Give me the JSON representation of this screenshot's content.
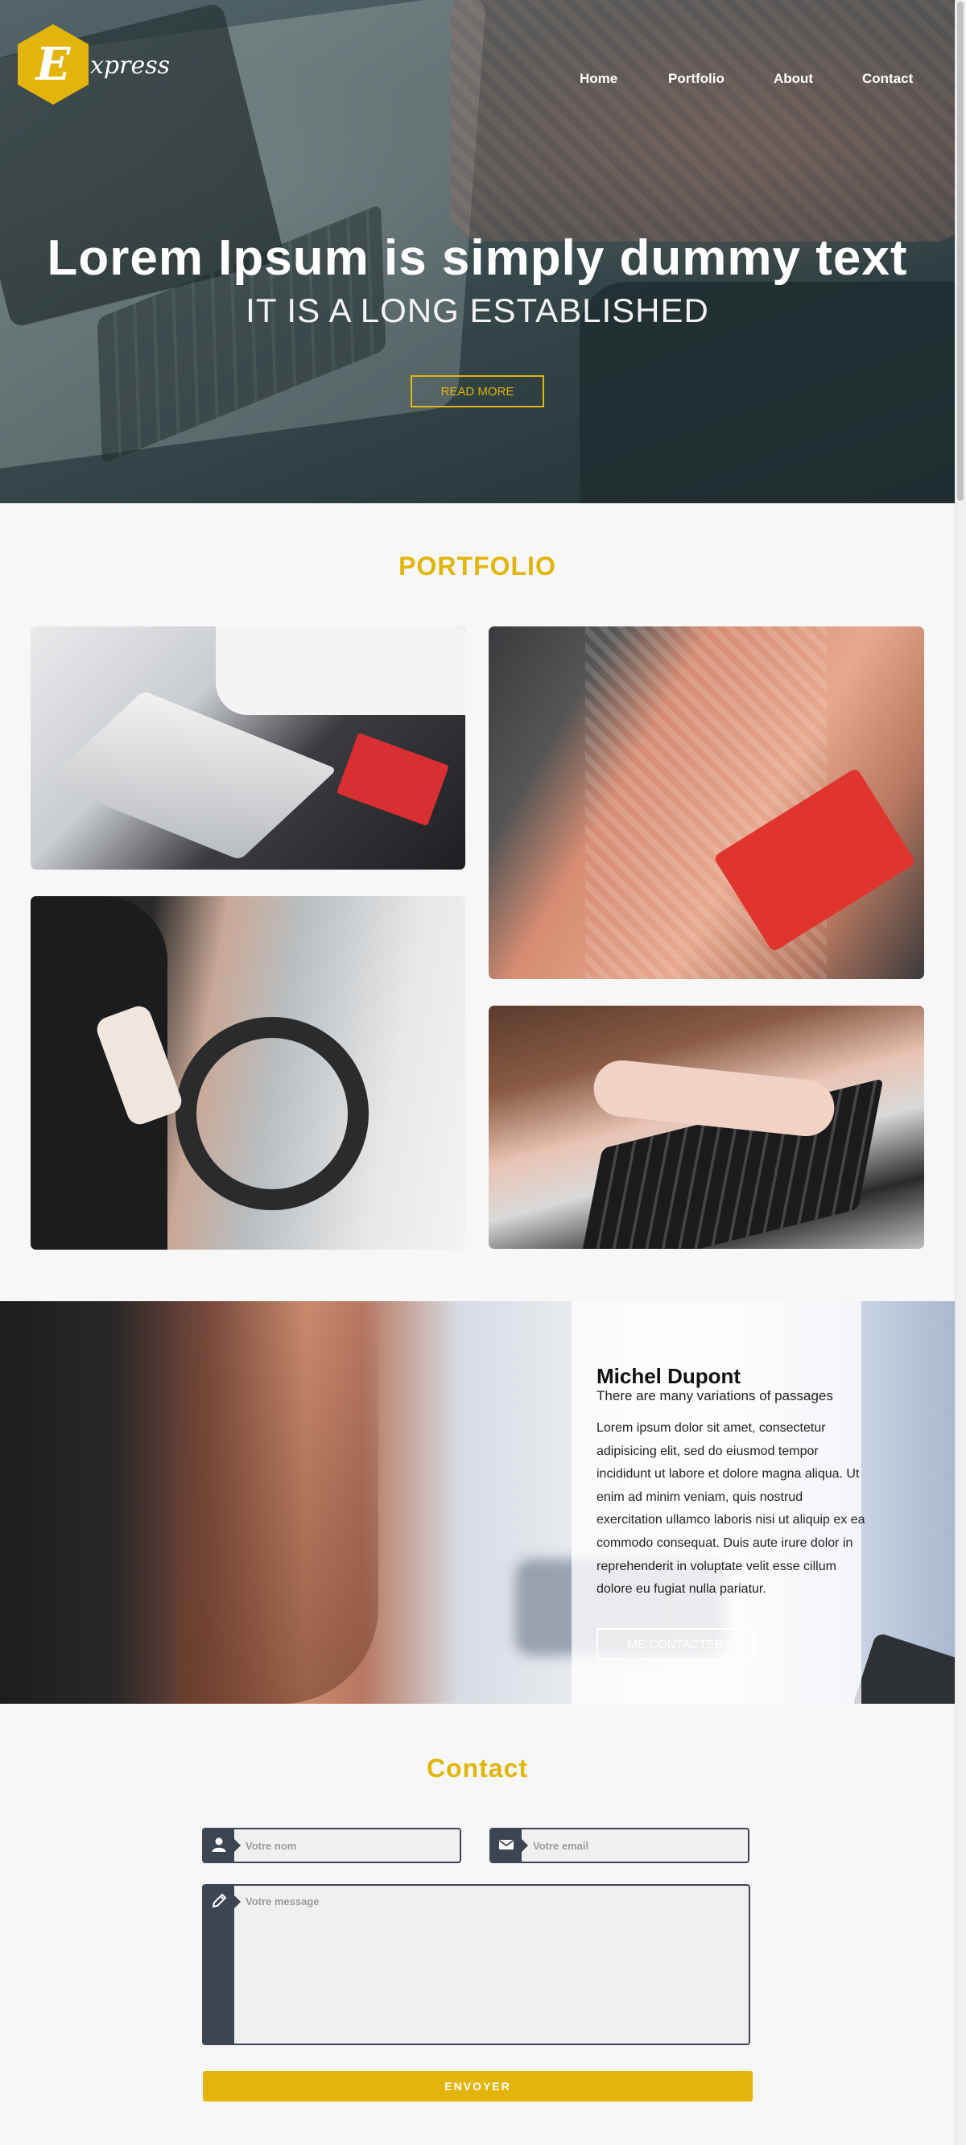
{
  "brand": {
    "letter": "E",
    "word": "xpress",
    "color": "#e3b40a"
  },
  "nav": {
    "items": [
      {
        "label": "Home"
      },
      {
        "label": "Portfolio"
      },
      {
        "label": "About"
      },
      {
        "label": "Contact"
      }
    ]
  },
  "hero": {
    "title": "Lorem Ipsum is simply dummy text",
    "subtitle": "IT IS A LONG ESTABLISHED",
    "button": "READ MORE"
  },
  "portfolio": {
    "title": "PORTFOLIO"
  },
  "about": {
    "name": "Michel Dupont",
    "tagline": "There are many variations of passages",
    "body": "Lorem ipsum dolor sit amet, consectetur adipisicing elit, sed do eiusmod tempor incididunt ut labore et dolore magna aliqua. Ut enim ad minim veniam, quis nostrud exercitation ullamco laboris nisi ut aliquip ex ea commodo consequat. Duis aute irure dolor in reprehenderit in voluptate velit esse cillum dolore eu fugiat nulla pariatur.",
    "button": "ME CONTACTER"
  },
  "contact": {
    "title": "Contact",
    "name_placeholder": "Votre nom",
    "email_placeholder": "Votre email",
    "message_placeholder": "Votre message",
    "name_icon": "user-icon",
    "email_icon": "envelope-icon",
    "message_icon": "pencil-icon",
    "submit": "ENVOYER"
  }
}
